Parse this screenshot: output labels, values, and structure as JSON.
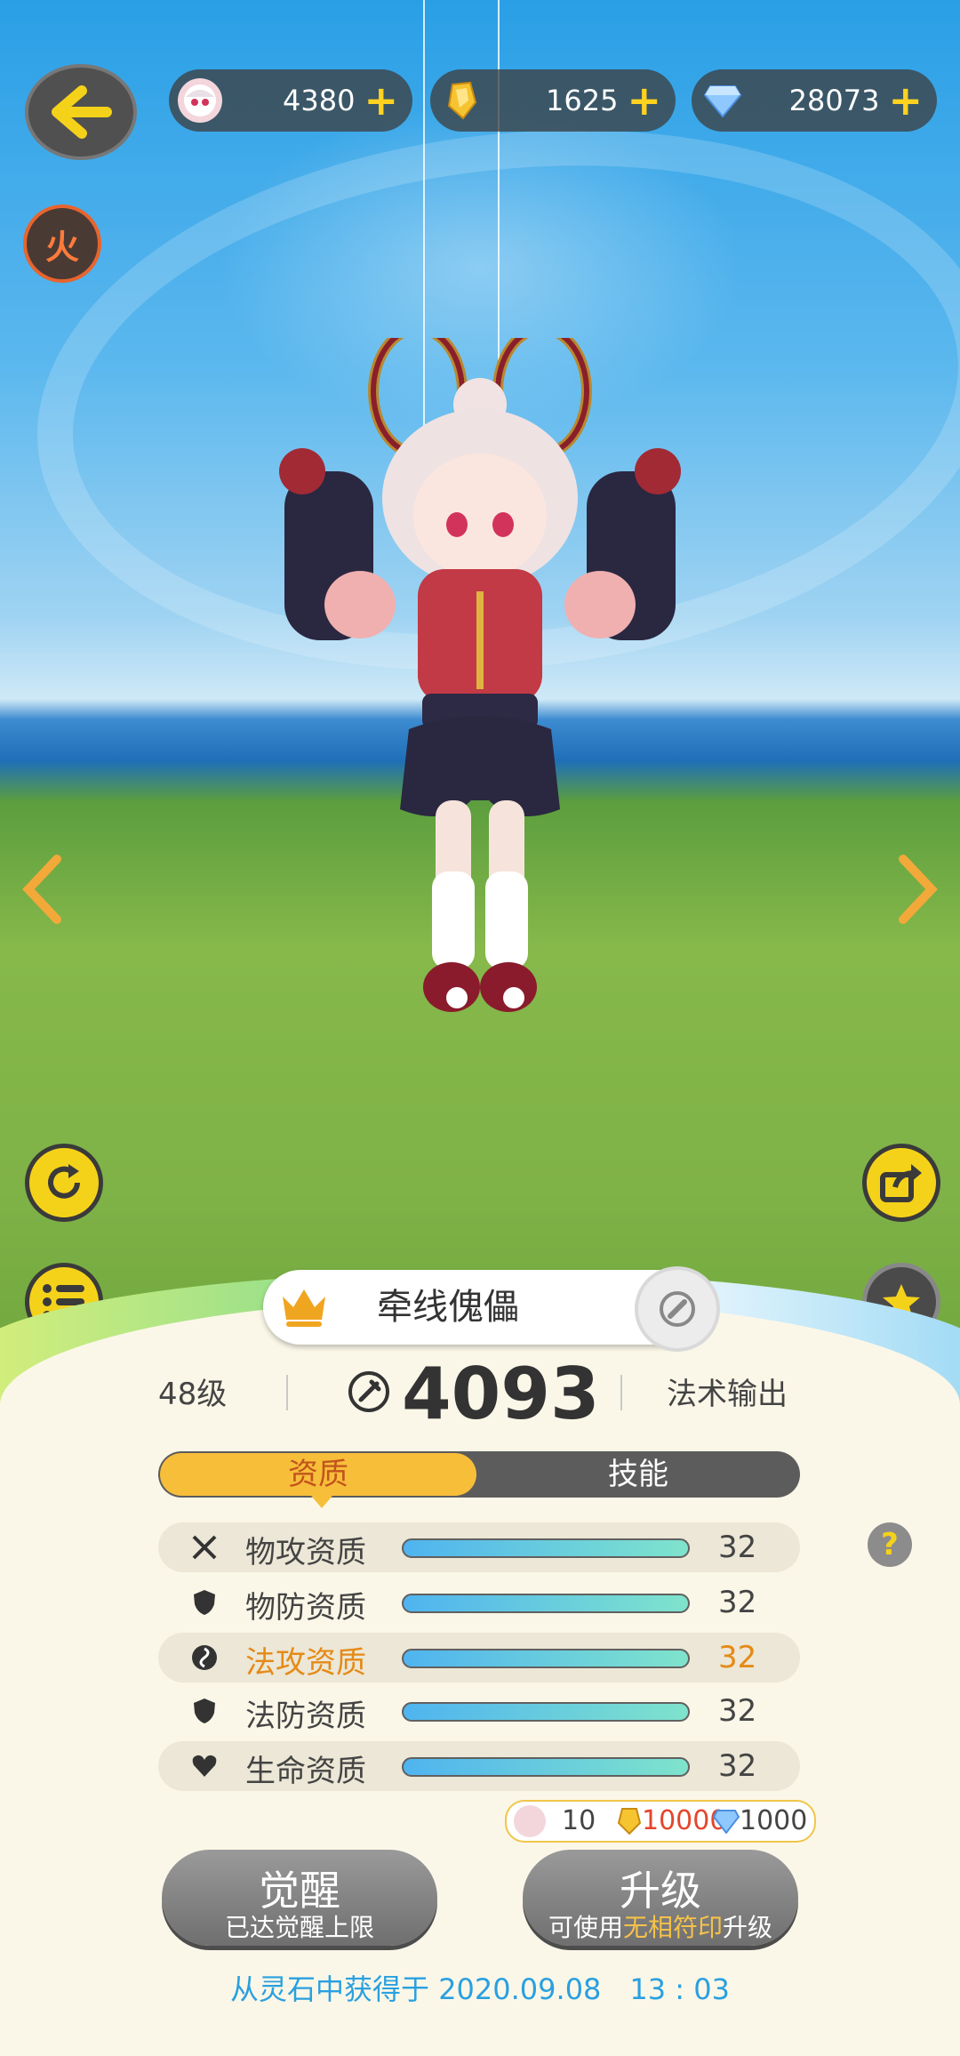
{
  "currencies": [
    {
      "icon": "avatar-token-icon",
      "value": "4380"
    },
    {
      "icon": "gold-crystal-icon",
      "value": "1625"
    },
    {
      "icon": "diamond-icon",
      "value": "28073"
    }
  ],
  "element_badge": "火",
  "character": {
    "name": "牵线傀儡",
    "level": "48级",
    "power": "4093",
    "role": "法术输出"
  },
  "tabs": [
    "资质",
    "技能"
  ],
  "stats": [
    {
      "label": "物攻资质",
      "value": "32",
      "icon": "sword-icon"
    },
    {
      "label": "物防资质",
      "value": "32",
      "icon": "shield-icon"
    },
    {
      "label": "法攻资质",
      "value": "32",
      "icon": "magic-swirl-icon"
    },
    {
      "label": "法防资质",
      "value": "32",
      "icon": "shield-icon"
    },
    {
      "label": "生命资质",
      "value": "32",
      "icon": "heart-icon"
    }
  ],
  "help_label": "?",
  "upgrade_cost": {
    "tokens": "10",
    "gold": "10000",
    "diamonds": "1000"
  },
  "buttons": {
    "awaken": {
      "title": "觉醒",
      "subtitle": "已达觉醒上限"
    },
    "upgrade": {
      "title": "升级",
      "subtitle_pre": "可使用",
      "subtitle_highlight": "无相符印",
      "subtitle_post": "升级"
    }
  },
  "obtain_text": "从灵石中获得于 2020.09.08　13 : 03",
  "colors": {
    "accent_yellow": "#f5d21a",
    "tab_active": "#f7be3a",
    "link_blue": "#2aa0e0",
    "warn_orange": "#e58a17",
    "cost_red": "#e4452e"
  }
}
